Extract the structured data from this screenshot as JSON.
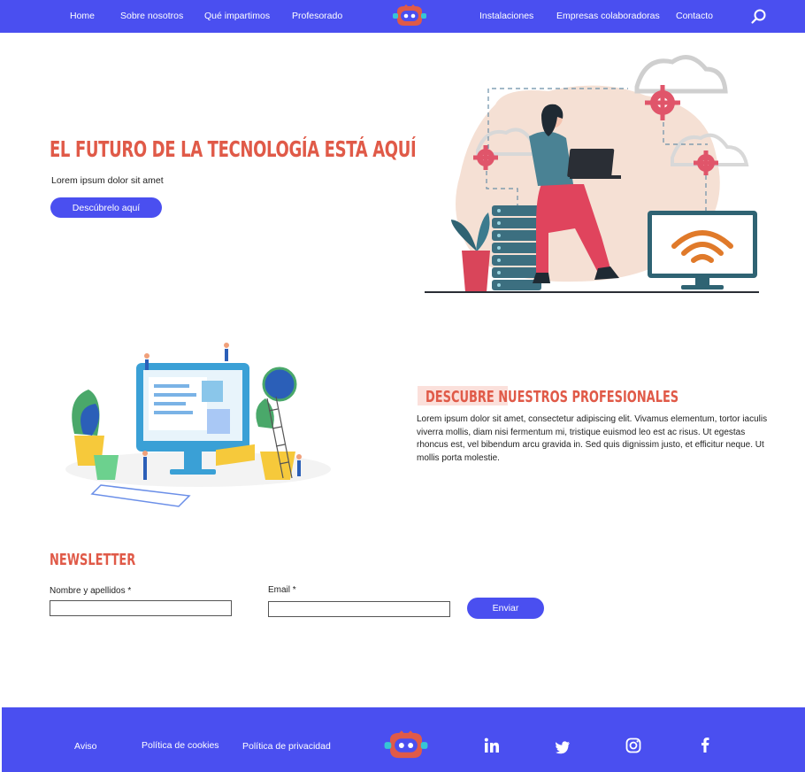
{
  "header": {
    "nav_left": [
      "Home",
      "Sobre nosotros",
      "Qué impartimos",
      "Profesorado"
    ],
    "nav_right": [
      "Instalaciones",
      "Empresas colaboradoras",
      "Contacto"
    ],
    "logo_icon": "robot-face-icon",
    "search_icon": "search-icon"
  },
  "hero": {
    "title": "EL FUTURO DE LA TECNOLOGÍA ESTÁ AQUÍ",
    "subtitle": "Lorem ipsum dolor sit amet",
    "cta": "Descúbrelo aquí",
    "illustration": "person-with-laptop-on-servers-illustration"
  },
  "professionals": {
    "title": "DESCUBRE NUESTROS PROFESIONALES",
    "body": "Lorem ipsum dolor sit amet, consectetur adipiscing elit. Vivamus elementum, tortor iaculis viverra mollis, diam nisi fermentum mi, tristique euismod leo est ac risus. Ut egestas rhoncus est, vel bibendum arcu gravida in. Sed quis dignissim justo, et efficitur neque. Ut mollis porta molestie.",
    "illustration": "team-building-website-illustration"
  },
  "newsletter": {
    "title": "NEWSLETTER",
    "name_label": "Nombre y apellidos *",
    "name_value": "",
    "email_label": "Email *",
    "email_value": "",
    "submit": "Enviar"
  },
  "footer": {
    "links": [
      "Aviso",
      "Política de cookies",
      "Política de privacidad"
    ],
    "social_icons": [
      "linkedin-icon",
      "twitter-icon",
      "instagram-icon",
      "facebook-icon"
    ]
  },
  "colors": {
    "brand_blue": "#4a4ff0",
    "accent_red": "#e05a48",
    "white": "#ffffff"
  }
}
